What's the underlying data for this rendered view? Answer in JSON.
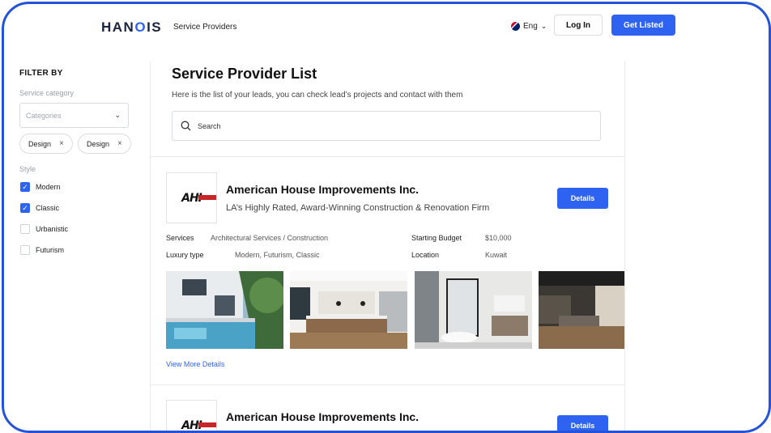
{
  "header": {
    "logo_prefix": "HAN",
    "logo_o": "O",
    "logo_suffix": "IS",
    "nav_link": "Service Providers",
    "language": "Eng",
    "login_label": "Log In",
    "get_listed_label": "Get Listed"
  },
  "sidebar": {
    "filter_title": "FILTER BY",
    "category_label": "Service category",
    "category_placeholder": "Categories",
    "chips": [
      "Design",
      "Design"
    ],
    "style_label": "Style",
    "styles": [
      {
        "label": "Modern",
        "checked": true
      },
      {
        "label": "Classic",
        "checked": true
      },
      {
        "label": "Urbanistic",
        "checked": false
      },
      {
        "label": "Futurism",
        "checked": false
      }
    ]
  },
  "main": {
    "title": "Service Provider List",
    "subtitle": "Here is the list of your leads, you can check lead’s projects and contact with them",
    "search_placeholder": "Search"
  },
  "providers": [
    {
      "logo_text": "AHI",
      "name": "American House Improvements Inc.",
      "tagline": "LA’s Highly Rated, Award-Winning Construction & Renovation Firm",
      "details_label": "Details",
      "services_label": "Services",
      "services_value": "Architectural Services / Construction",
      "luxury_label": "Luxury type",
      "luxury_value": "Modern, Futurism, Classic",
      "budget_label": "Starting Budget",
      "budget_value": "$10,000",
      "location_label": "Location",
      "location_value": "Kuwait",
      "more_link": "View More Details"
    },
    {
      "logo_text": "AHI",
      "name": "American House Improvements Inc.",
      "details_label": "Details"
    }
  ],
  "icons": {
    "search": "search-icon",
    "chevron": "chevron-down-icon",
    "close": "close-icon",
    "check": "check-icon",
    "flag": "uk-flag-icon"
  },
  "colors": {
    "accent": "#2e63f2",
    "frame": "#2452d8"
  }
}
